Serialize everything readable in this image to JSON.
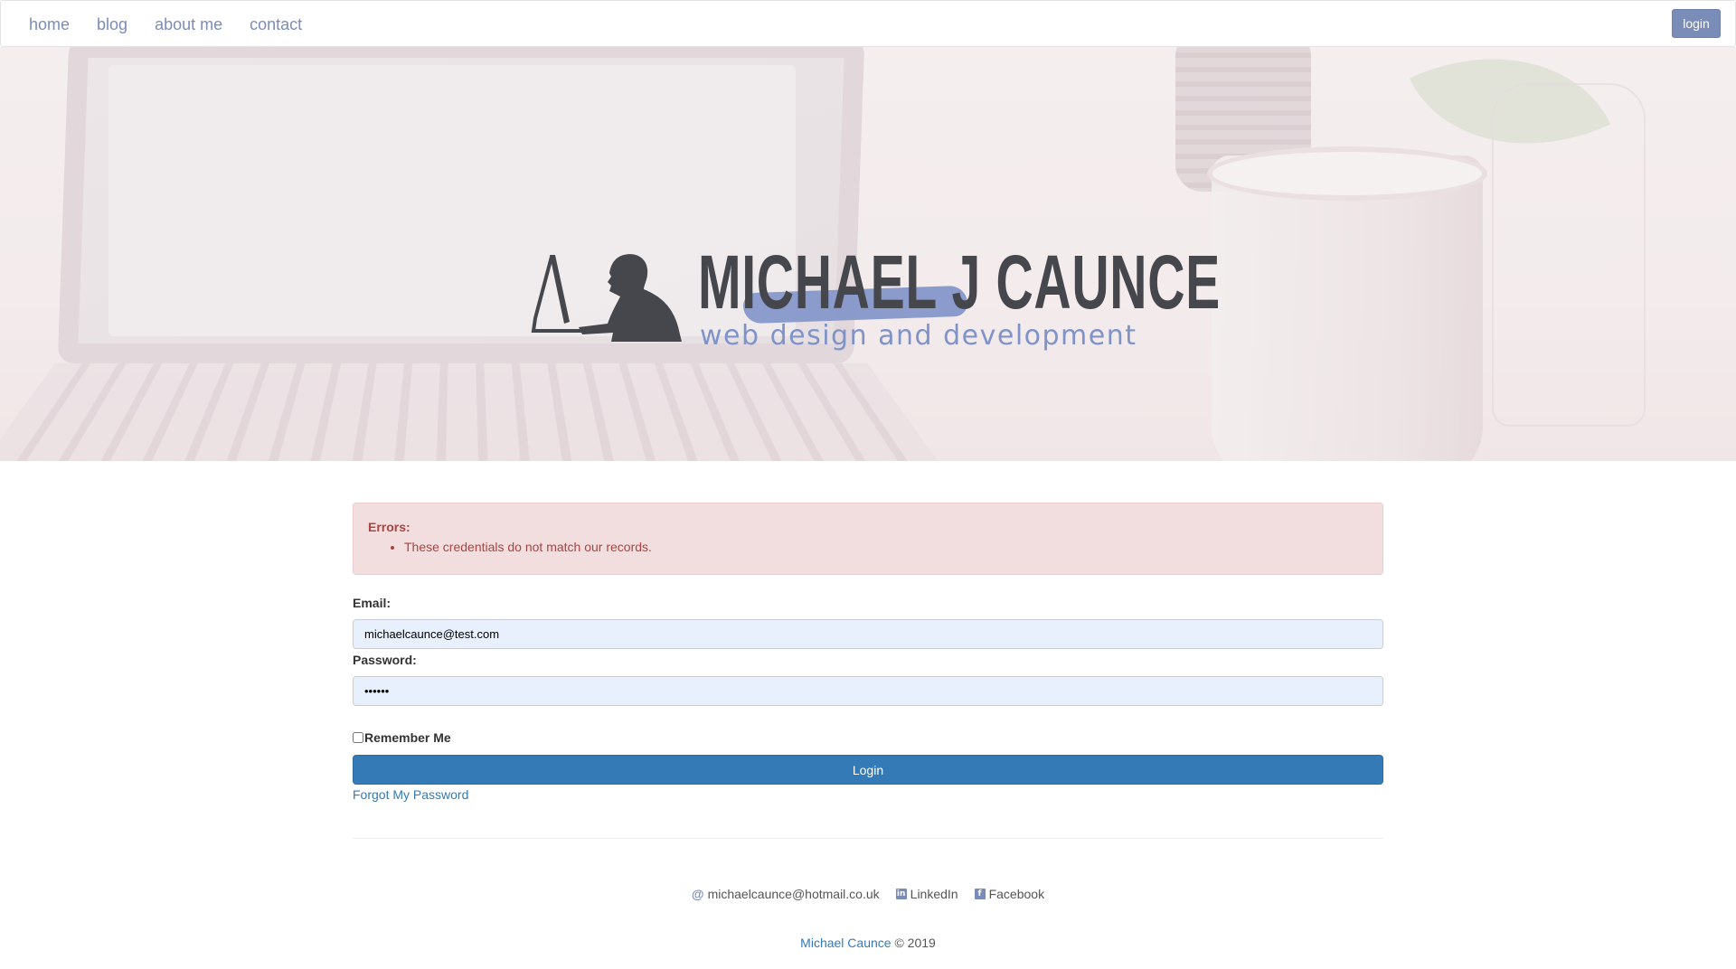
{
  "nav": {
    "links": [
      {
        "label": "home"
      },
      {
        "label": "blog"
      },
      {
        "label": "about me"
      },
      {
        "label": "contact"
      }
    ],
    "login_label": "login"
  },
  "hero": {
    "logo_name": "MICHAEL J CAUNCE",
    "logo_tagline": "web design and development"
  },
  "alert": {
    "title": "Errors:",
    "messages": [
      "These credentials do not match our records."
    ]
  },
  "form": {
    "email_label": "Email:",
    "email_value": "michaelcaunce@test.com",
    "password_label": "Password:",
    "password_value": "••••••",
    "remember_label": "Remember Me",
    "remember_checked": false,
    "submit_label": "Login",
    "forgot_label": "Forgot My Password"
  },
  "footer": {
    "email": "michaelcaunce@hotmail.co.uk",
    "email_icon": "at-icon",
    "linkedin": "LinkedIn",
    "linkedin_icon": "linkedin-icon",
    "facebook": "Facebook",
    "facebook_icon": "facebook-icon",
    "copyright_name": "Michael Caunce",
    "copyright_text": "© 2019"
  },
  "colors": {
    "nav_link": "#7a8cb8",
    "primary": "#337ab7",
    "alert_bg": "#f2dede",
    "alert_text": "#a94442",
    "logo_dark": "#45474c",
    "logo_accent": "#7f93c9"
  }
}
